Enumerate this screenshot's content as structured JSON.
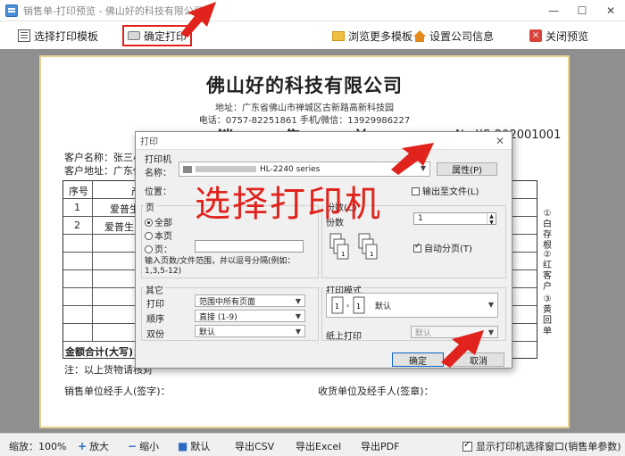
{
  "window": {
    "title": "销售单-打印预览 - 佛山好的科技有限公司",
    "minimize": "—",
    "maximize": "☐",
    "close": "✕"
  },
  "toolbar": {
    "select_template": "选择打印模板",
    "confirm_print": "确定打印",
    "browse_more_templates": "浏览更多模板",
    "company_settings": "设置公司信息",
    "close_preview": "关闭预览"
  },
  "document": {
    "company": "佛山好的科技有限公司",
    "address": "地址：广东省佛山市禅城区古新路高新科技园",
    "contact": "电话：0757-82251861 手机/微信：13929986227",
    "title": "销 售 单",
    "number": "No:XS-202001001",
    "customer_name_label": "客户名称：张三小",
    "customer_address_label": "客户地址：广东佛",
    "columns": [
      "序号",
      "产"
    ],
    "rows": [
      {
        "no": "1",
        "product": "爱普生"
      },
      {
        "no": "2",
        "product": "爱普生"
      }
    ],
    "total_label": "金额合计(大写)：",
    "note": "注：以上货物请核对",
    "seller_sign": "销售单位经手人(签字)：",
    "receiver_sign": "收货单位及经手人(签章)：",
    "side_labels": [
      "①白存根",
      "②红客户",
      "③黄回单"
    ]
  },
  "dialog": {
    "title": "打印",
    "printer_group": "打印机",
    "name_label": "名称：",
    "printer_name": "HL-2240 series",
    "properties_button": "属性(P)",
    "location_label": "位置：",
    "print_to_file": "输出至文件(L)",
    "pages_group": "页",
    "all_pages": "全部",
    "current_page": "本页",
    "pages_radio": "页：",
    "pages_hint": "输入页数/文件范围，并以逗号分隔(例如：1,3,5-12)",
    "copies_group": "份数(C)",
    "copies_label": "份数",
    "copies_value": "1",
    "collate": "自动分页(T)",
    "other_group": "其它",
    "print_label": "打印",
    "print_value": "范围中所有页面",
    "order_label": "顺序",
    "order_value": "直接 (1-9)",
    "duplex_label": "双份",
    "duplex_value": "默认",
    "mode_group": "打印模式",
    "mode_value": "默认",
    "paper_print_label": "纸上打印",
    "paper_print_value": "默认",
    "ok_button": "确定",
    "cancel_button": "取消"
  },
  "overlay": {
    "text": "选择打印机"
  },
  "statusbar": {
    "zoom": "缩放：100%",
    "zoom_in": "放大",
    "zoom_out": "缩小",
    "default": "默认",
    "export_csv": "导出CSV",
    "export_excel": "导出Excel",
    "export_pdf": "导出PDF",
    "show_printer_dialog": "显示打印机选择窗口(销售单参数)"
  },
  "colors": {
    "annotation_red": "#e0231c",
    "preview_bg": "#8f8f8f",
    "paper_border": "#e8d090",
    "accent_blue": "#2a6bc2"
  }
}
